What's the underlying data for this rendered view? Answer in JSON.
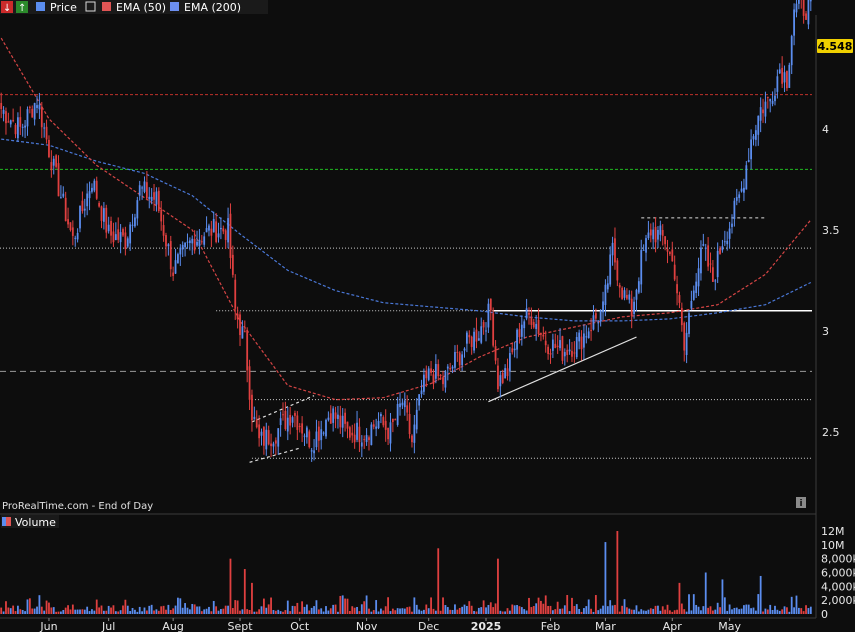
{
  "toolbar": {
    "legend": [
      {
        "label": "Price",
        "color": "#5b8def"
      },
      {
        "label": "EMA (50)",
        "color": "#e05555"
      },
      {
        "label": "EMA (200)",
        "color": "#6c8ff0"
      }
    ]
  },
  "volume_panel": {
    "label": "Volume"
  },
  "watermark": "ProRealTime.com - End of Day",
  "info_icon": "i",
  "last_price_label": "4.548",
  "colors": {
    "background": "#0d0d0d",
    "up_candle": "#5b8def",
    "down_candle": "#e04040",
    "ema50": "#d64545",
    "ema200": "#4a78d8",
    "resistance_red": "#c0302a",
    "support_green": "#20b820",
    "price_tag": "#f0d000"
  },
  "chart_data": [
    {
      "type": "candlestick",
      "title": "",
      "series": [
        {
          "name": "Price"
        },
        {
          "name": "EMA (50)",
          "x": [
            0,
            20,
            40,
            60,
            80,
            100,
            120,
            140,
            160,
            180,
            200,
            220,
            240,
            260,
            280,
            300,
            320,
            339
          ],
          "values": [
            4.45,
            4.05,
            3.82,
            3.66,
            3.5,
            3.05,
            2.73,
            2.66,
            2.67,
            2.74,
            2.87,
            2.97,
            3.02,
            3.07,
            3.09,
            3.13,
            3.28,
            3.55
          ]
        },
        {
          "name": "EMA (200)",
          "x": [
            0,
            20,
            40,
            60,
            80,
            100,
            120,
            140,
            160,
            180,
            200,
            220,
            240,
            260,
            280,
            300,
            320,
            339
          ],
          "values": [
            3.95,
            3.92,
            3.84,
            3.78,
            3.67,
            3.48,
            3.3,
            3.2,
            3.14,
            3.12,
            3.1,
            3.07,
            3.05,
            3.05,
            3.06,
            3.09,
            3.13,
            3.24
          ]
        }
      ],
      "bars": 340,
      "x_labels": [
        {
          "label": "Jun",
          "x": 20
        },
        {
          "label": "Jul",
          "x": 45
        },
        {
          "label": "Aug",
          "x": 72
        },
        {
          "label": "Sept",
          "x": 100
        },
        {
          "label": "Oct",
          "x": 125
        },
        {
          "label": "Nov",
          "x": 153
        },
        {
          "label": "Dec",
          "x": 179
        },
        {
          "label": "2025",
          "x": 203
        },
        {
          "label": "Feb",
          "x": 230
        },
        {
          "label": "Mar",
          "x": 253
        },
        {
          "label": "Apr",
          "x": 281
        },
        {
          "label": "May",
          "x": 305
        }
      ],
      "y_ticks": [
        2.5,
        3,
        3.5,
        4
      ],
      "ylim": [
        2.3,
        4.7
      ],
      "anchors": [
        [
          0,
          4.1
        ],
        [
          8,
          4.0
        ],
        [
          15,
          4.15
        ],
        [
          22,
          3.8
        ],
        [
          30,
          3.45
        ],
        [
          38,
          3.75
        ],
        [
          45,
          3.48
        ],
        [
          52,
          3.45
        ],
        [
          58,
          3.7
        ],
        [
          65,
          3.65
        ],
        [
          72,
          3.3
        ],
        [
          80,
          3.45
        ],
        [
          88,
          3.5
        ],
        [
          95,
          3.5
        ],
        [
          98,
          3.1
        ],
        [
          102,
          2.95
        ],
        [
          105,
          2.6
        ],
        [
          108,
          2.45
        ],
        [
          115,
          2.5
        ],
        [
          122,
          2.6
        ],
        [
          130,
          2.45
        ],
        [
          138,
          2.6
        ],
        [
          145,
          2.5
        ],
        [
          152,
          2.5
        ],
        [
          158,
          2.55
        ],
        [
          163,
          2.5
        ],
        [
          168,
          2.65
        ],
        [
          172,
          2.45
        ],
        [
          176,
          2.7
        ],
        [
          180,
          2.8
        ],
        [
          185,
          2.75
        ],
        [
          190,
          2.85
        ],
        [
          196,
          2.95
        ],
        [
          200,
          3.0
        ],
        [
          205,
          3.1
        ],
        [
          208,
          2.75
        ],
        [
          212,
          2.8
        ],
        [
          218,
          3.05
        ],
        [
          222,
          3.08
        ],
        [
          228,
          2.95
        ],
        [
          235,
          2.9
        ],
        [
          242,
          2.95
        ],
        [
          248,
          3.05
        ],
        [
          252,
          3.1
        ],
        [
          256,
          3.4
        ],
        [
          260,
          3.2
        ],
        [
          264,
          3.1
        ],
        [
          268,
          3.35
        ],
        [
          272,
          3.5
        ],
        [
          278,
          3.45
        ],
        [
          282,
          3.3
        ],
        [
          286,
          2.9
        ],
        [
          290,
          3.25
        ],
        [
          294,
          3.4
        ],
        [
          298,
          3.25
        ],
        [
          302,
          3.45
        ],
        [
          306,
          3.55
        ],
        [
          310,
          3.7
        ],
        [
          314,
          3.95
        ],
        [
          318,
          4.1
        ],
        [
          322,
          4.15
        ],
        [
          326,
          4.3
        ],
        [
          329,
          4.25
        ],
        [
          332,
          4.6
        ],
        [
          339,
          4.6
        ]
      ],
      "levels": [
        {
          "name": "resistance-red-dashed",
          "y": 4.17,
          "style": "red-dash"
        },
        {
          "name": "support-green-dashed",
          "y": 3.8,
          "style": "green-dash"
        },
        {
          "name": "dotted-level-upper",
          "y": 3.41,
          "style": "white-dot"
        },
        {
          "name": "neckline-white",
          "y": 3.1,
          "style": "white-solid",
          "x_from": 206
        },
        {
          "name": "dotted-neckline-left",
          "y": 3.1,
          "style": "white-dot",
          "x_from": 90,
          "x_to": 206
        },
        {
          "name": "gray-dashed-level",
          "y": 2.8,
          "style": "gray-dash"
        },
        {
          "name": "dotted-level-lower",
          "y": 2.66,
          "style": "white-dot",
          "x_from": 105
        },
        {
          "name": "dotted-level-bottom",
          "y": 2.37,
          "style": "white-dot",
          "x_from": 105
        },
        {
          "name": "short-dotted-top",
          "y": 3.56,
          "style": "white-dash",
          "x_from": 268,
          "x_to": 320
        }
      ],
      "trendlines": [
        {
          "name": "rising-trendline",
          "x1": 204,
          "y1": 2.65,
          "x2": 266,
          "y2": 2.97,
          "style": "white-solid"
        },
        {
          "name": "channel-upper",
          "x1": 105,
          "y1": 2.55,
          "x2": 131,
          "y2": 2.68,
          "style": "white-dash"
        },
        {
          "name": "channel-lower",
          "x1": 104,
          "y1": 2.35,
          "x2": 125,
          "y2": 2.42,
          "style": "white-dash"
        }
      ]
    },
    {
      "type": "bar",
      "title": "Volume",
      "y_ticks": [
        "0",
        "2,000k",
        "4,000k",
        "6,000k",
        "8,000k",
        "10M",
        "12M"
      ],
      "ylim": [
        0,
        12000000
      ],
      "spikes": [
        {
          "x": 96,
          "v": 8000000
        },
        {
          "x": 102,
          "v": 6500000
        },
        {
          "x": 105,
          "v": 4500000
        },
        {
          "x": 183,
          "v": 9500000
        },
        {
          "x": 208,
          "v": 8000000
        },
        {
          "x": 253,
          "v": 10400000
        },
        {
          "x": 258,
          "v": 12000000
        },
        {
          "x": 284,
          "v": 4500000
        },
        {
          "x": 295,
          "v": 6000000
        },
        {
          "x": 302,
          "v": 5000000
        },
        {
          "x": 318,
          "v": 5500000
        }
      ]
    }
  ]
}
